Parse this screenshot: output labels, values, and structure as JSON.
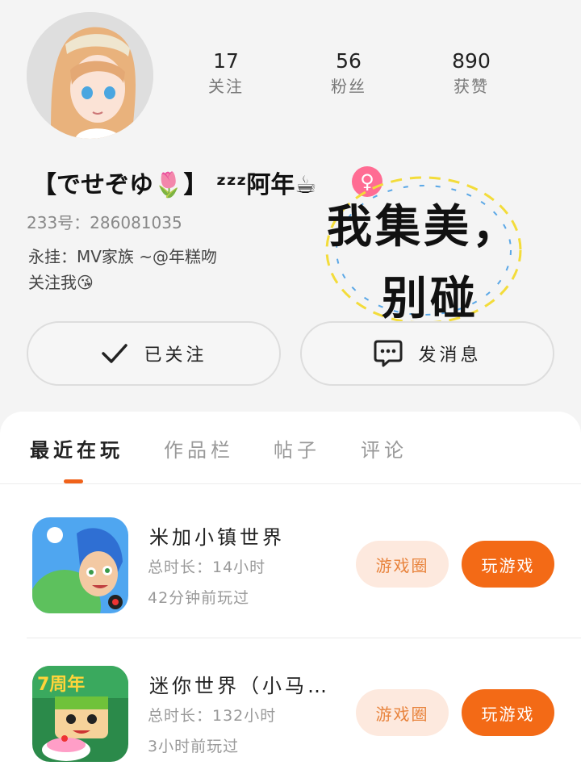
{
  "profile": {
    "name": "【でせぞゆ🌷】 ᶻᶻᶻ阿年☕",
    "gender_icon": "♀",
    "uid": "233号：286081035",
    "bio": "永挂：MV家族 ~@年糕吻\n关注我😘"
  },
  "stats": [
    {
      "value": "17",
      "label": "关注"
    },
    {
      "value": "56",
      "label": "粉丝"
    },
    {
      "value": "890",
      "label": "获赞"
    }
  ],
  "sticker": {
    "line1": "我集美，",
    "line2": "别碰"
  },
  "actions": {
    "follow_label": "已关注",
    "message_label": "发消息"
  },
  "tabs": [
    "最近在玩",
    "作品栏",
    "帖子",
    "评论"
  ],
  "games": [
    {
      "title": "米加小镇世界",
      "duration": "总时长：14小时",
      "last_played": "42分钟前玩过",
      "circle_label": "游戏圈",
      "play_label": "玩游戏"
    },
    {
      "title": "迷你世界（小马…",
      "duration": "总时长：132小时",
      "last_played": "3小时前玩过",
      "circle_label": "游戏圈",
      "play_label": "玩游戏"
    }
  ],
  "icons": [
    "avatar-anime-girl",
    "checkmark-icon",
    "chat-bubble-icon",
    "female-icon"
  ],
  "colors": {
    "accent": "#f36a16",
    "accent_light": "#fde9de",
    "gender": "#ff6c93"
  }
}
